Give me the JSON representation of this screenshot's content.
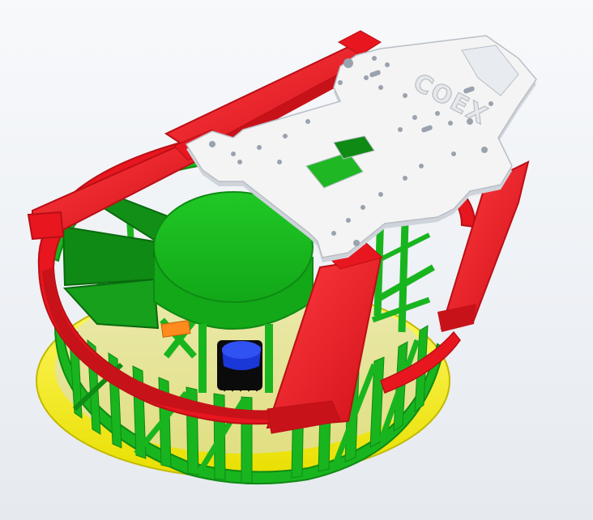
{
  "viewport": {
    "background_top": "#f7f9fb",
    "background_bottom": "#e6eaef"
  },
  "model": {
    "plate_logo_text": "COEX",
    "colors": {
      "frame_red": "#e8161f",
      "frame_red_dark": "#b90f16",
      "cage_green": "#19b51f",
      "cage_green_dark": "#0f8a14",
      "base_yellow": "#f6ee00",
      "plate_white": "#f4f4f4",
      "plate_shadow": "#cfd4da",
      "motor_blue": "#1a37d8",
      "motor_black": "#0b0b0b",
      "accent_orange": "#ff8a1e"
    }
  }
}
